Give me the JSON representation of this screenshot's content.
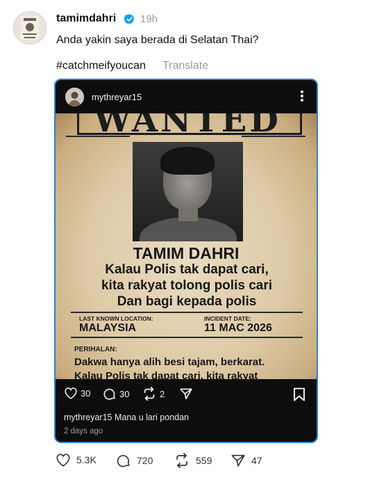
{
  "post": {
    "author": "tamimdahri",
    "time": "19h",
    "text": "Anda yakin saya berada di Selatan Thai?",
    "hashtag": "#catchmeifyoucan",
    "translate": "Translate"
  },
  "embed": {
    "username": "mythreyar15",
    "poster": {
      "wanted": "WANTED",
      "name": "TAMIM DAHRI",
      "slogan": [
        "Kalau Polis tak dapat cari,",
        "kita rakyat tolong polis cari",
        "Dan bagi kepada polis"
      ],
      "location_label": "LAST KNOWN LOCATION:",
      "location_value": "MALAYSIA",
      "incident_label": "INCIDENT DATE:",
      "incident_value": "11 MAC 2026",
      "perihalan_label": "PERIHALAN:",
      "description": [
        "Dakwa hanya alih besi tajam, berkarat.",
        "Kalau Polis tak dapat cari, kita rakyat"
      ]
    },
    "likes": "30",
    "comments": "30",
    "reposts": "2",
    "caption_user": "mythreyar15",
    "caption_text": "Mana u lari pondan",
    "date": "2 days ago"
  },
  "stats": {
    "likes": "5.3K",
    "replies": "720",
    "reposts": "559",
    "shares": "47"
  },
  "colors": {
    "verified": "#1d9bf0",
    "embed_border": "#2f7fd8",
    "muted": "#9a9a9a"
  },
  "icons": [
    "heart-icon",
    "comment-icon",
    "repost-icon",
    "share-icon",
    "bookmark-icon",
    "more-icon",
    "verified-badge-icon"
  ]
}
